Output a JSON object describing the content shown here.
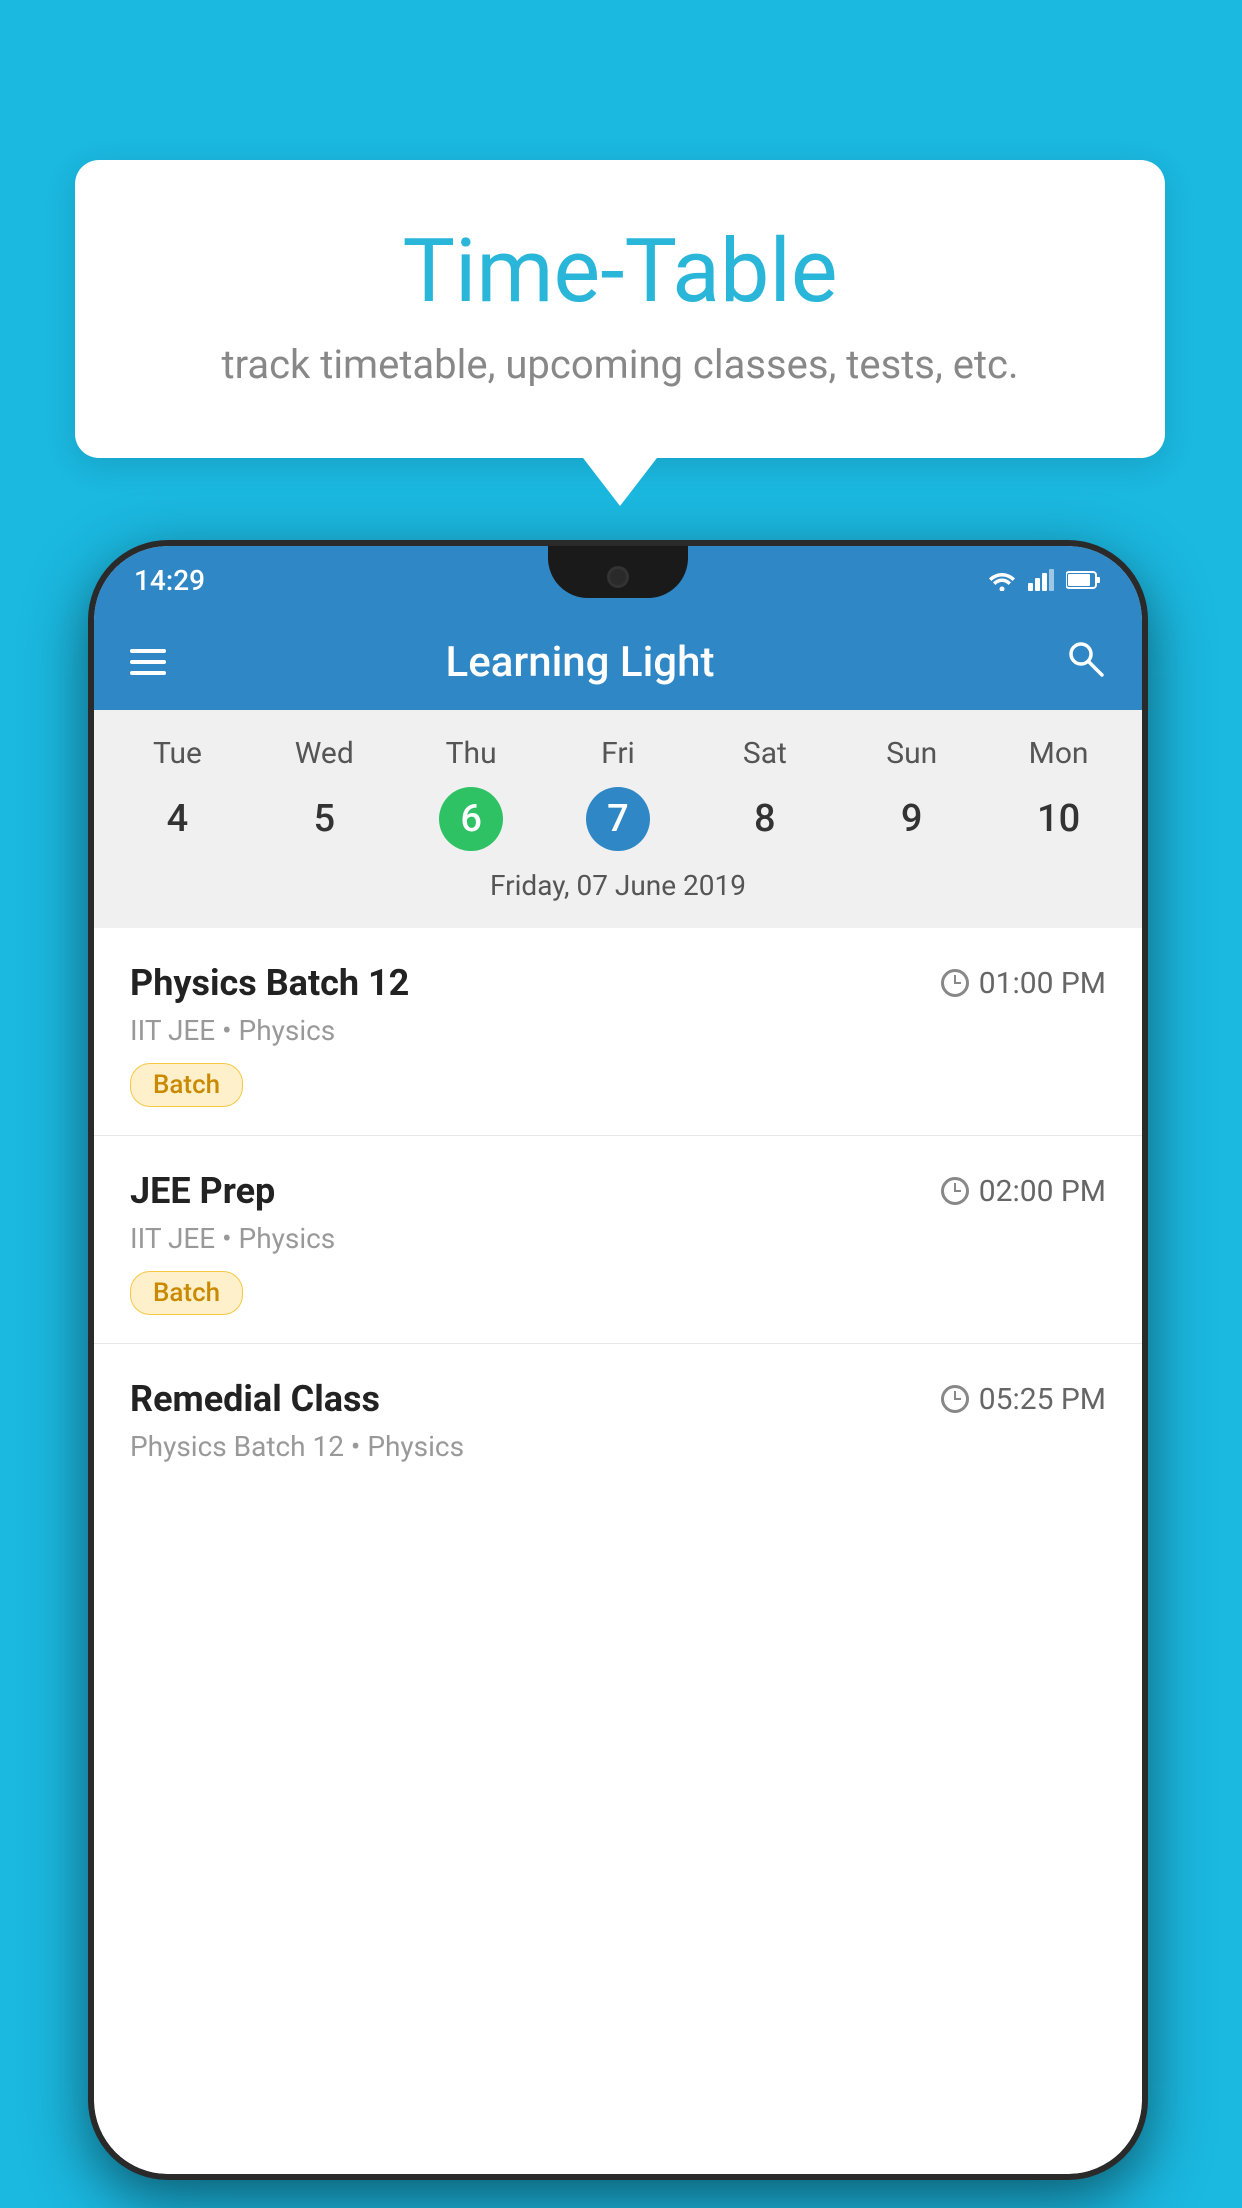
{
  "background": {
    "color": "#1BB8E0"
  },
  "tooltip": {
    "title": "Time-Table",
    "subtitle": "track timetable, upcoming classes, tests, etc."
  },
  "phone": {
    "status_bar": {
      "time": "14:29"
    },
    "app_bar": {
      "title": "Learning Light"
    },
    "calendar": {
      "days": [
        {
          "label": "Tue",
          "number": "4"
        },
        {
          "label": "Wed",
          "number": "5"
        },
        {
          "label": "Thu",
          "number": "6",
          "state": "today"
        },
        {
          "label": "Fri",
          "number": "7",
          "state": "selected"
        },
        {
          "label": "Sat",
          "number": "8"
        },
        {
          "label": "Sun",
          "number": "9"
        },
        {
          "label": "Mon",
          "number": "10"
        }
      ],
      "selected_date_label": "Friday, 07 June 2019"
    },
    "schedule": [
      {
        "title": "Physics Batch 12",
        "time": "01:00 PM",
        "subtitle": "IIT JEE • Physics",
        "badge": "Batch"
      },
      {
        "title": "JEE Prep",
        "time": "02:00 PM",
        "subtitle": "IIT JEE • Physics",
        "badge": "Batch"
      },
      {
        "title": "Remedial Class",
        "time": "05:25 PM",
        "subtitle": "Physics Batch 12 • Physics",
        "badge": null
      }
    ]
  }
}
